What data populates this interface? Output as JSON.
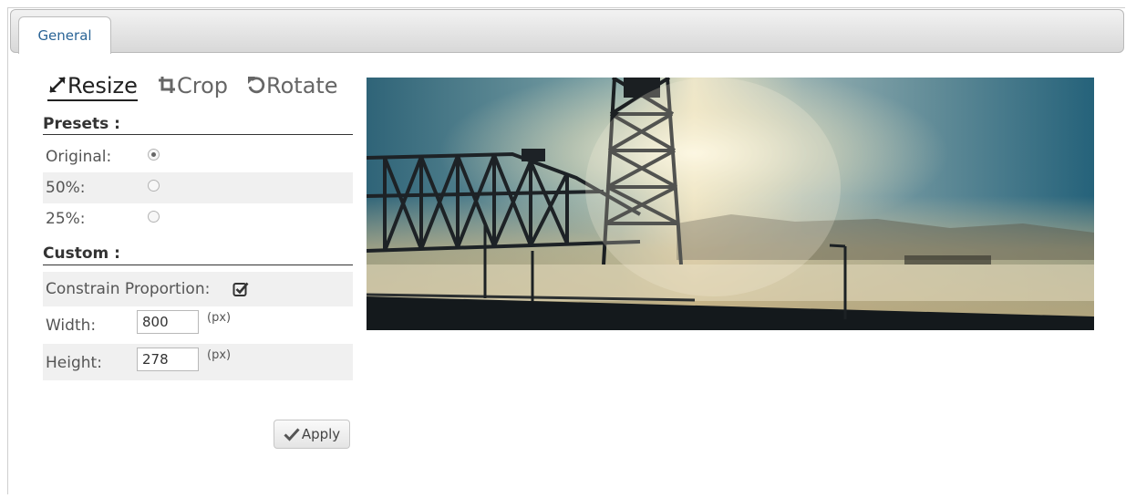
{
  "tabs": [
    {
      "label": "General",
      "active": true
    }
  ],
  "toolbar": {
    "resize_label": "Resize",
    "crop_label": "Crop",
    "rotate_label": "Rotate",
    "active": "resize"
  },
  "presets": {
    "title": "Presets :",
    "options": [
      {
        "label": "Original:",
        "selected": true
      },
      {
        "label": "50%:",
        "selected": false
      },
      {
        "label": "25%:",
        "selected": false
      }
    ]
  },
  "custom": {
    "title": "Custom :",
    "constrain_label": "Constrain Proportion:",
    "constrain_checked": true,
    "width_label": "Width:",
    "width_value": "800",
    "width_unit": "(px)",
    "height_label": "Height:",
    "height_value": "278",
    "height_unit": "(px)"
  },
  "apply_label": "Apply",
  "preview_image": "bridge-in-fog-photo",
  "colors": {
    "accent": "#2a6496"
  }
}
